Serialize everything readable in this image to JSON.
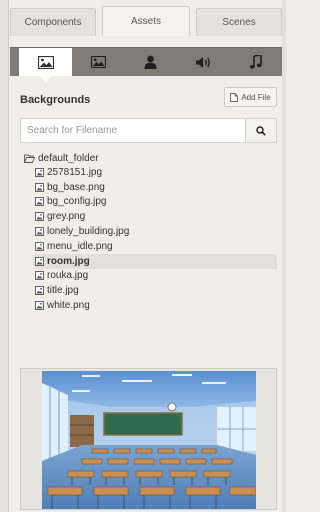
{
  "tabs": [
    {
      "label": "Components",
      "active": false
    },
    {
      "label": "Assets",
      "active": true
    },
    {
      "label": "Scenes",
      "active": false
    }
  ],
  "toolbar": {
    "icons": [
      "image-icon",
      "picture-icon",
      "character-icon",
      "speaker-icon",
      "music-icon"
    ],
    "active_index": 0
  },
  "section": {
    "title": "Backgrounds",
    "add_file_label": "Add File"
  },
  "search": {
    "placeholder": "Search for Filename",
    "value": ""
  },
  "tree": {
    "folder": "default_folder",
    "files": [
      {
        "name": "2578151.jpg",
        "selected": false
      },
      {
        "name": "bg_base.png",
        "selected": false
      },
      {
        "name": "bg_config.jpg",
        "selected": false
      },
      {
        "name": "grey.png",
        "selected": false
      },
      {
        "name": "lonely_building.jpg",
        "selected": false
      },
      {
        "name": "menu_idle.png",
        "selected": false
      },
      {
        "name": "room.jpg",
        "selected": true
      },
      {
        "name": "rouka.jpg",
        "selected": false
      },
      {
        "name": "title.jpg",
        "selected": false
      },
      {
        "name": "white.png",
        "selected": false
      }
    ]
  },
  "colors": {
    "toolbar_bg": "#7f7c78",
    "panel_bg": "#f0eee9",
    "selected_row": "#e2e0db"
  }
}
